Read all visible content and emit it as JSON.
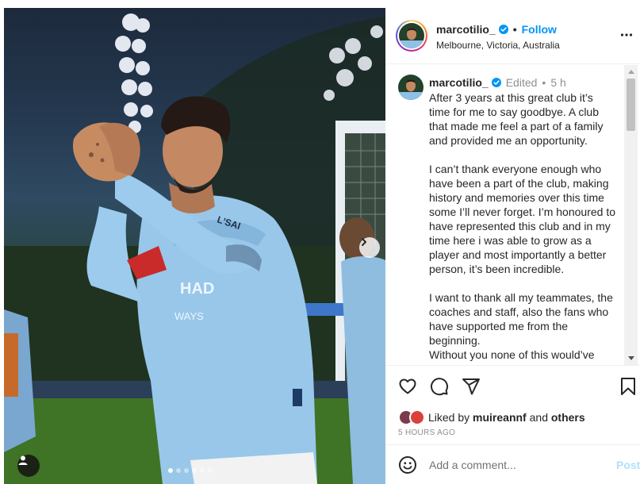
{
  "post": {
    "username": "marcotilio_",
    "follow_label": "Follow",
    "separator": "•",
    "location": "Melbourne, Victoria, Australia"
  },
  "caption": {
    "username": "marcotilio_",
    "edited_label": "Edited",
    "separator": "•",
    "time": "5 h",
    "paragraphs": [
      "After 3 years at this great club it’s time for me to say goodbye. A club that made me feel a part of a family and provided me an opportunity.",
      "I can’t thank everyone enough who have been a part of the club, making history and memories over this time some I’ll never forget. I’m honoured to have represented this club and in my time here i was able to grow as a player and most importantly a better person, it’s been incredible.",
      "I want to thank all my teammates, the coaches and staff, also the fans who have supported me from the beginning.",
      "Without you none of this would’ve"
    ]
  },
  "likes": {
    "prefix": "Liked by",
    "user": "muireannf",
    "and": "and",
    "others": "others"
  },
  "time_ago": "5 HOURS AGO",
  "comment": {
    "placeholder": "Add a comment...",
    "post_label": "Post"
  },
  "carousel": {
    "total": 6,
    "active": 0
  },
  "icons": {
    "verified": "verified-badge-icon",
    "more": "more-options-icon",
    "like": "heart-icon",
    "comment": "comment-icon",
    "share": "share-icon",
    "save": "bookmark-icon",
    "emoji": "emoji-icon",
    "next": "chevron-right-icon",
    "tags": "user-tag-icon"
  },
  "colors": {
    "accent": "#0095f6",
    "post_disabled": "#b2dffc",
    "muted": "#8e8e8e",
    "verified": "#0095f6"
  }
}
